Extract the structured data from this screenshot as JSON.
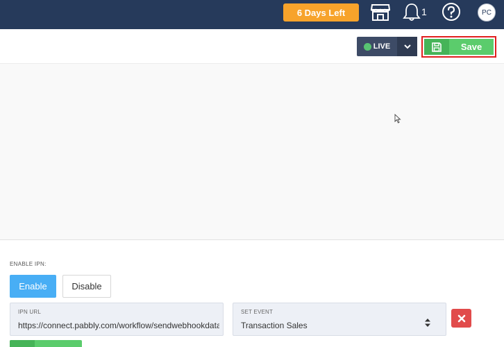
{
  "header": {
    "trial_badge": "6 Days Left",
    "notification_count": "1",
    "avatar_initials": "PC",
    "icons": [
      "store-icon",
      "bell-icon",
      "help-icon"
    ]
  },
  "toolbar": {
    "live_label": "LIVE",
    "save_label": "Save",
    "icons": [
      "live-dot-icon",
      "chevron-down-icon",
      "floppy-disk-icon"
    ]
  },
  "ipn": {
    "enable_ipn_label": "ENABLE IPN:",
    "enable_label": "Enable",
    "disable_label": "Disable",
    "url_label": "IPN URL",
    "url_value": "https://connect.pabbly.com/workflow/sendwebhookdata",
    "event_label": "SET EVENT",
    "event_value": "Transaction Sales",
    "icons": [
      "select-arrows-icon",
      "close-icon"
    ]
  },
  "colors": {
    "header_bg": "#263a5b",
    "trial_badge": "#f7a32b",
    "save_green": "#5bcc6c",
    "enable_blue": "#48aef5",
    "delete_red": "#e14b4b",
    "highlight_border": "#e01f1f"
  }
}
